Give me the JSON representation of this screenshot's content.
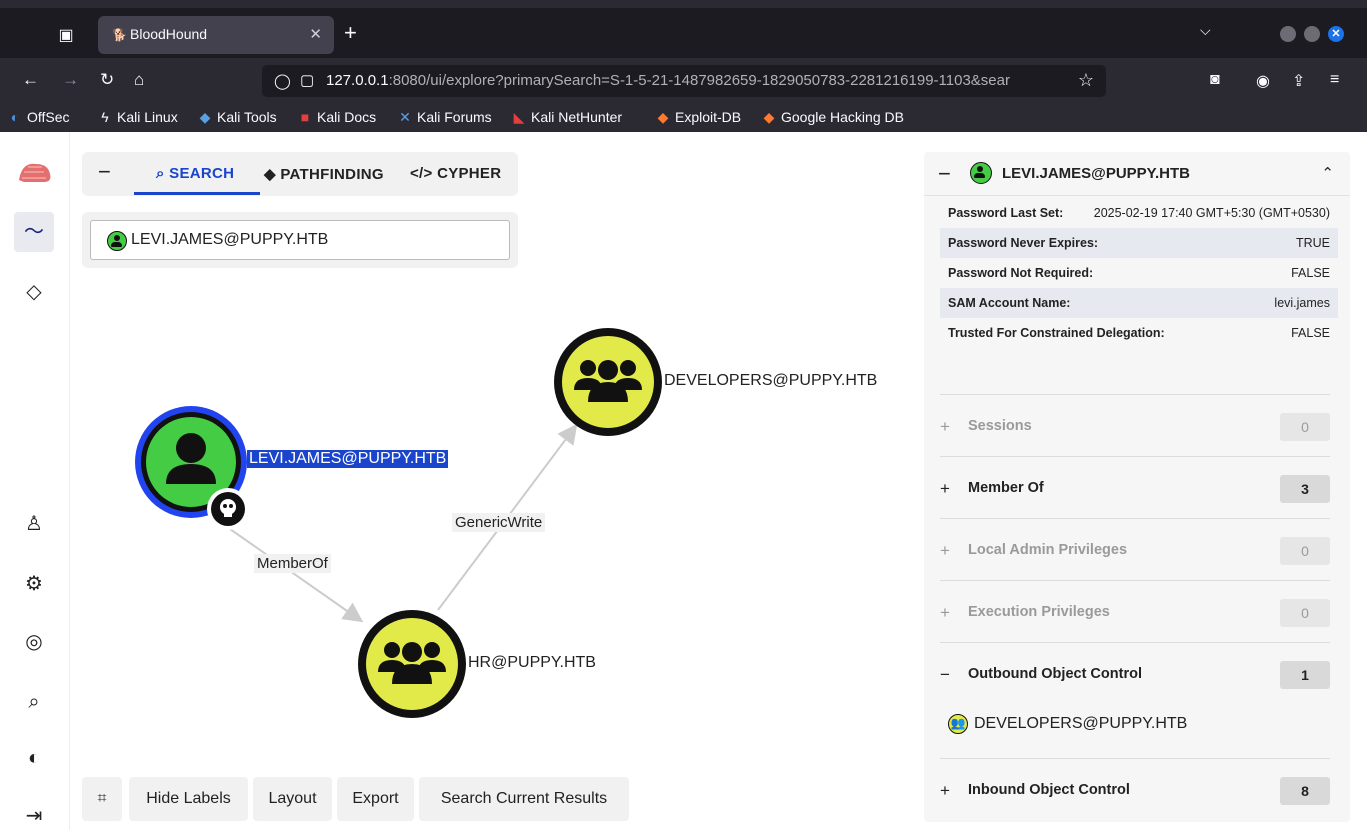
{
  "browser": {
    "tab_title": "BloodHound",
    "url_host": "127.0.0.1",
    "url_rest": ":8080/ui/explore?primarySearch=S-1-5-21-1487982659-1829050783-2281216199-1103&sear",
    "bookmarks": [
      "OffSec",
      "Kali Linux",
      "Kali Tools",
      "Kali Docs",
      "Kali Forums",
      "Kali NetHunter",
      "Exploit-DB",
      "Google Hacking DB"
    ]
  },
  "topnav": {
    "search": "SEARCH",
    "pathfinding": "PATHFINDING",
    "cypher": "CYPHER"
  },
  "search": {
    "value": "LEVI.JAMES@PUPPY.HTB"
  },
  "graph": {
    "nodes": {
      "levi": "LEVI.JAMES@PUPPY.HTB",
      "developers": "DEVELOPERS@PUPPY.HTB",
      "hr": "HR@PUPPY.HTB"
    },
    "edges": {
      "memberof": "MemberOf",
      "genericwrite": "GenericWrite"
    }
  },
  "bottombar": {
    "hide_labels": "Hide Labels",
    "layout": "Layout",
    "export": "Export",
    "search_current": "Search Current Results"
  },
  "panel": {
    "title": "LEVI.JAMES@PUPPY.HTB",
    "props": [
      {
        "k": "Password Last Set:",
        "v": "2025-02-19 17:40 GMT+5:30 (GMT+0530)"
      },
      {
        "k": "Password Never Expires:",
        "v": "TRUE"
      },
      {
        "k": "Password Not Required:",
        "v": "FALSE"
      },
      {
        "k": "SAM Account Name:",
        "v": "levi.james"
      },
      {
        "k": "Trusted For Constrained Delegation:",
        "v": "FALSE"
      }
    ],
    "sections": [
      {
        "sign": "+",
        "name": "Sessions",
        "count": "0"
      },
      {
        "sign": "+",
        "name": "Member Of",
        "count": "3"
      },
      {
        "sign": "+",
        "name": "Local Admin Privileges",
        "count": "0"
      },
      {
        "sign": "+",
        "name": "Execution Privileges",
        "count": "0"
      },
      {
        "sign": "−",
        "name": "Outbound Object Control",
        "count": "1"
      },
      {
        "sign": "+",
        "name": "Inbound Object Control",
        "count": "8"
      }
    ],
    "outbound_item": "DEVELOPERS@PUPPY.HTB"
  },
  "colors": {
    "user_node": "#44cc44",
    "group_node": "#e2ea4a",
    "accent": "#1a44cc"
  }
}
